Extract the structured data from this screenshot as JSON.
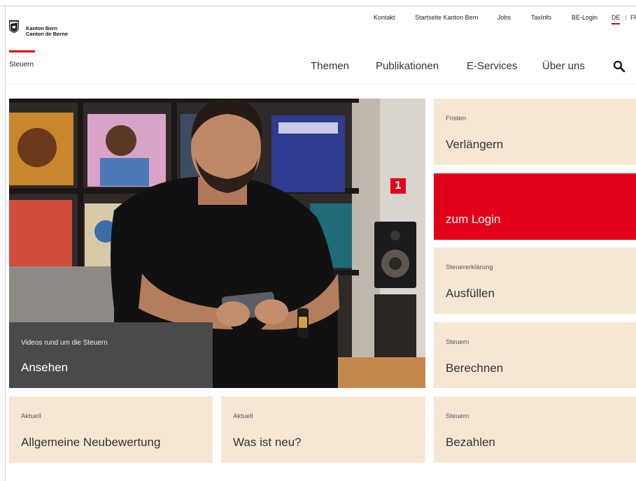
{
  "header": {
    "logo_line1": "Kanton Bern",
    "logo_line2": "Canton de Berne",
    "site_name": "Steuern"
  },
  "meta_nav": {
    "contact": "Kontakt",
    "home": "Startseite Kanton Bern",
    "jobs": "Jobs",
    "taxinfo": "TaxInfo",
    "be_login": "BE-Login",
    "lang_de": "DE",
    "separator": "|",
    "lang_fr": "FR"
  },
  "main_nav": {
    "themen": "Themen",
    "publikationen": "Publikationen",
    "eservices": "E-Services",
    "ueber_uns": "Über uns",
    "search_icon": "search-icon"
  },
  "hero": {
    "video_small": "Videos rund um die Steuern",
    "video_big": "Ansehen"
  },
  "annotation_badge": "1",
  "tiles": [
    {
      "small": "Fristen",
      "big": "Verlängern"
    },
    {
      "small": "",
      "big": "zum Login"
    },
    {
      "small": "Steuererklärung",
      "big": "Ausfüllen"
    },
    {
      "small": "Steuern",
      "big": "Berechnen"
    },
    {
      "small": "Aktuell",
      "big": "Allgemeine Neubewertung"
    },
    {
      "small": "Aktuell",
      "big": "Was ist neu?"
    },
    {
      "small": "Steuern",
      "big": "Bezahlen"
    }
  ],
  "colors": {
    "brand_red": "#e3001b",
    "tile_beige": "#f6e7d4",
    "video_box": "#4a4a4a"
  }
}
